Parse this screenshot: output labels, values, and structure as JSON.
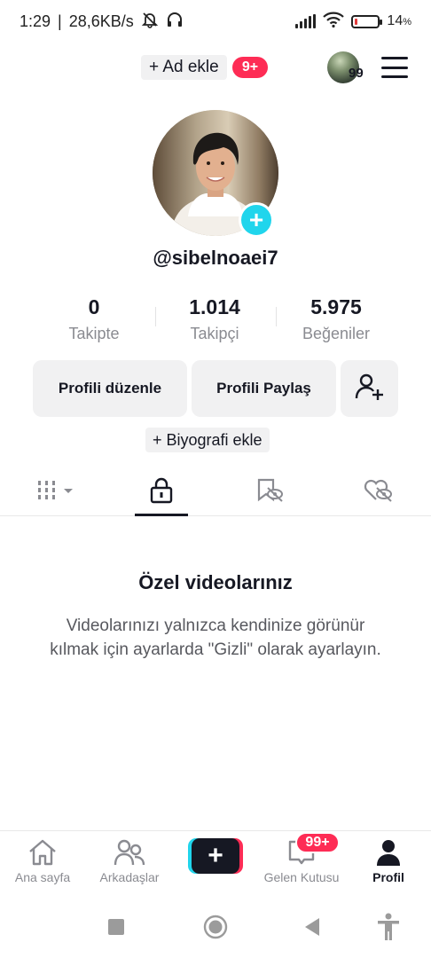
{
  "status_bar": {
    "time": "1:29",
    "network_speed": "28,6KB/s",
    "battery_percent": "14",
    "battery_unit": "%",
    "battery_level": 0.14
  },
  "top_bar": {
    "add_name_label": "+ Ad ekle",
    "notification_badge": "9+",
    "account_count": "99"
  },
  "profile": {
    "username": "@sibelnoaei7",
    "stats": [
      {
        "value": "0",
        "label": "Takipte"
      },
      {
        "value": "1.014",
        "label": "Takipçi"
      },
      {
        "value": "5.975",
        "label": "Beğeniler"
      }
    ],
    "edit_button": "Profili düzenle",
    "share_button": "Profili Paylaş",
    "add_bio": "+ Biyografi ekle"
  },
  "tabs": [
    "videos-grid",
    "private",
    "reposts-hidden",
    "liked-hidden"
  ],
  "empty_state": {
    "title": "Özel videolarınız",
    "description": "Videolarınızı yalnızca kendinize görünür kılmak için ayarlarda \"Gizli\" olarak ayarlayın."
  },
  "bottom_nav": {
    "home": "Ana sayfa",
    "friends": "Arkadaşlar",
    "create": "+",
    "inbox": "Gelen Kutusu",
    "inbox_badge": "99+",
    "profile": "Profil"
  },
  "colors": {
    "accent_red": "#fe2c55",
    "accent_cyan": "#20d5ec",
    "text_primary": "#161823",
    "text_secondary": "#8a8b91"
  }
}
